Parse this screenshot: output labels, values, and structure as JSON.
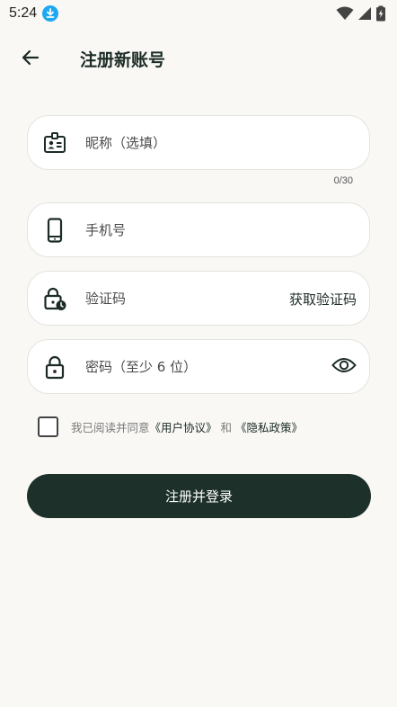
{
  "status_bar": {
    "time": "5:24",
    "icons": [
      "download-badge-icon",
      "wifi-icon",
      "signal-icon",
      "battery-icon"
    ]
  },
  "app_bar": {
    "title": "注册新账号",
    "back_icon": "arrow-left-icon"
  },
  "form": {
    "nickname": {
      "placeholder": "昵称（选填）",
      "value": "",
      "counter": "0/30",
      "icon": "id-card-icon"
    },
    "phone": {
      "placeholder": "手机号",
      "value": "",
      "icon": "phone-icon"
    },
    "code": {
      "placeholder": "验证码",
      "value": "",
      "action_label": "获取验证码",
      "icon": "lock-clock-icon"
    },
    "password": {
      "placeholder": "密码（至少 6 位）",
      "value": "",
      "icon": "lock-icon",
      "toggle_icon": "eye-icon"
    }
  },
  "agreement": {
    "prefix": "我已阅读并同意",
    "user_agreement": "《用户协议》",
    "joiner": "和",
    "privacy_policy": "《隐私政策》",
    "checked": false
  },
  "submit_label": "注册并登录",
  "colors": {
    "background": "#f9f8f5",
    "primary": "#1d302a",
    "download_badge": "#1ea7f2"
  }
}
